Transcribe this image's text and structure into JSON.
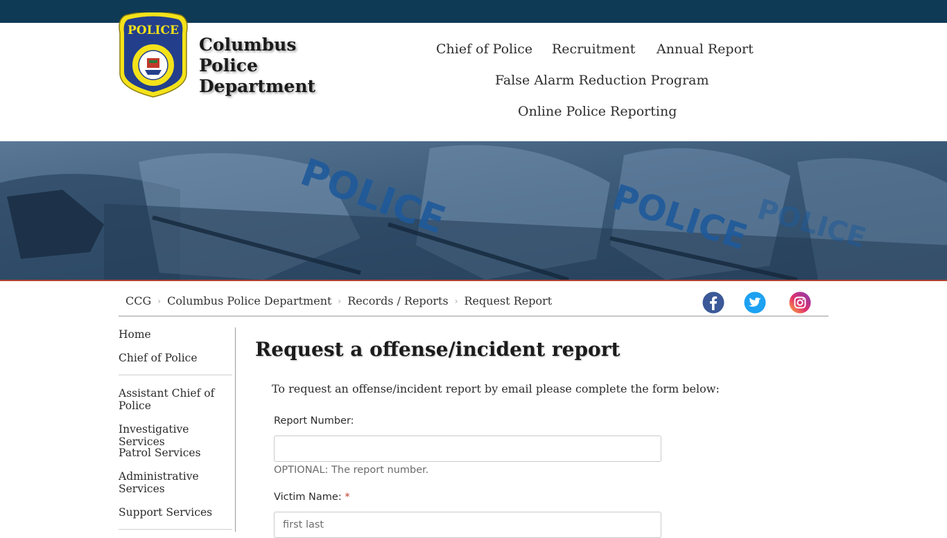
{
  "header": {
    "badge_top_text": "POLICE",
    "site_title_line1": "Columbus Police",
    "site_title_line2": "Department",
    "nav": [
      "Chief of Police",
      "Recruitment",
      "Annual Report",
      "False Alarm Reduction Program",
      "Online Police Reporting"
    ]
  },
  "hero": {
    "words": [
      "POLICE",
      "POLICE",
      "POLICE"
    ]
  },
  "breadcrumb": [
    "CCG",
    "Columbus Police Department",
    "Records / Reports",
    "Request Report"
  ],
  "breadcrumb_sep": "›",
  "social": {
    "icons": [
      "facebook-icon",
      "twitter-icon",
      "instagram-icon"
    ]
  },
  "sidebar": {
    "items": [
      "Home",
      "Chief of Police",
      "Assistant Chief of Police",
      "Investigative Services",
      "Patrol Services",
      "Administrative Services",
      "Support Services"
    ]
  },
  "main": {
    "title": "Request a offense/incident report",
    "intro": "To request an offense/incident report by email please complete the form below:"
  },
  "form": {
    "report_number_label": "Report Number:",
    "report_number_value": "",
    "report_number_help": "OPTIONAL: The report number.",
    "victim_name_label": "Victim Name:",
    "victim_name_required": "*",
    "victim_name_placeholder": "first last"
  },
  "colors": {
    "topbar": "#0e3a55",
    "hero": "#3b5a78",
    "accent_line": "#b3402f",
    "facebook": "#3b5998",
    "twitter": "#1da1f2",
    "required": "#c0392b"
  }
}
